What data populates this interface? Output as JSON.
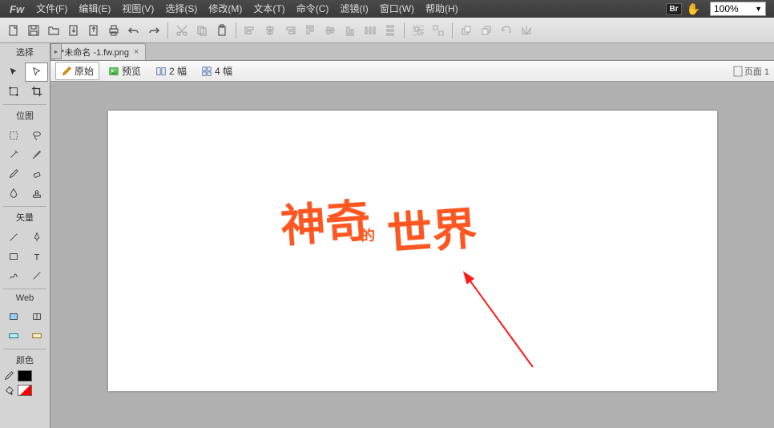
{
  "app": {
    "logo": "Fw"
  },
  "menu": [
    {
      "label": "文件(F)"
    },
    {
      "label": "编辑(E)"
    },
    {
      "label": "视图(V)"
    },
    {
      "label": "选择(S)"
    },
    {
      "label": "修改(M)"
    },
    {
      "label": "文本(T)"
    },
    {
      "label": "命令(C)"
    },
    {
      "label": "滤镜(I)"
    },
    {
      "label": "窗口(W)"
    },
    {
      "label": "帮助(H)"
    }
  ],
  "topright": {
    "br": "Br",
    "zoom": "100%"
  },
  "doc_tab": {
    "name": "*未命名 -1.fw.png"
  },
  "view_bar": {
    "original": "原始",
    "preview": "预览",
    "two_up": "2 幅",
    "four_up": "4 幅",
    "page": "页面 1"
  },
  "tools_panel": {
    "select": "选择",
    "bitmap": "位图",
    "vector": "矢量",
    "web": "Web",
    "colors": "颜色",
    "stroke_color": "#000000",
    "fill_color": "#ff0000"
  },
  "canvas_text": {
    "t1": "神奇",
    "t2": "的",
    "t3": "世界"
  }
}
